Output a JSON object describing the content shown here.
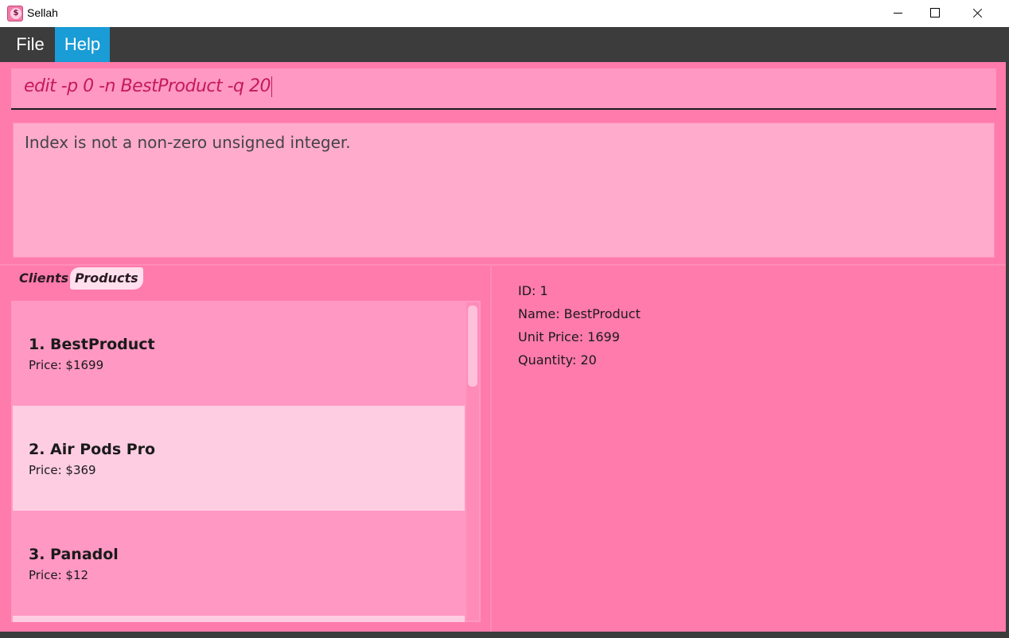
{
  "window": {
    "title": "Sellah",
    "icon": "dollar-icon"
  },
  "menu": {
    "file_label": "File",
    "help_label": "Help"
  },
  "command": {
    "value": "edit -p 0 -n BestProduct -q 20"
  },
  "result": {
    "message": "Index is not a non-zero unsigned integer."
  },
  "tabs": {
    "clients_label": "Clients",
    "products_label": "Products",
    "selected": "Products"
  },
  "products": [
    {
      "name": "1.  BestProduct",
      "price": "Price: $1699"
    },
    {
      "name": "2.  Air Pods Pro",
      "price": "Price: $369"
    },
    {
      "name": "3.  Panadol",
      "price": "Price: $12"
    }
  ],
  "detail": {
    "id": "ID: 1",
    "name": "Name: BestProduct",
    "unit_price": "Unit Price: 1699",
    "quantity": "Quantity: 20"
  },
  "colors": {
    "background": "#ff7bab",
    "accent": "#1a9cd6",
    "command_text": "#c41a5a"
  }
}
